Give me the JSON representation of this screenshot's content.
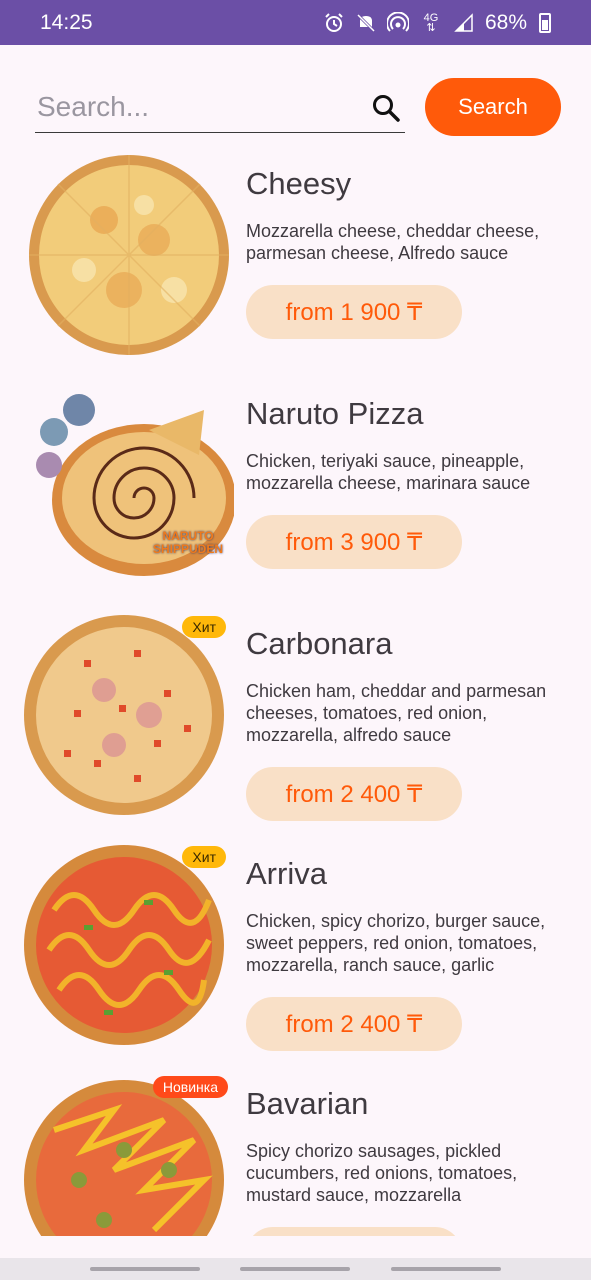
{
  "status_bar": {
    "time": "14:25",
    "battery": "68%",
    "icons": [
      "alarm-icon",
      "mute-icon",
      "hotspot-icon",
      "4g-icon",
      "signal-icon",
      "battery-icon"
    ]
  },
  "search": {
    "placeholder": "Search...",
    "value": "",
    "button_label": "Search"
  },
  "colors": {
    "status_bar": "#6b4fa6",
    "accent": "#ff5a0a",
    "price_bg": "#f9e0c7",
    "badge_hit": "#ffb80a",
    "badge_new": "#ff4a1a"
  },
  "products": [
    {
      "name": "Cheesy",
      "description": "Mozzarella cheese, cheddar cheese, parmesan cheese, Alfredo sauce",
      "price": "from 1 900 ₸",
      "badge": ""
    },
    {
      "name": "Naruto Pizza",
      "description": "Chicken, teriyaki sauce, pineapple, mozzarella cheese, marinara sauce",
      "price": "from 3 900 ₸",
      "badge": "",
      "logo_text": "NARUTO SHIPPUDEN"
    },
    {
      "name": "Carbonara",
      "description": "Chicken ham, cheddar and parmesan cheeses, tomatoes, red onion, mozzarella, alfredo sauce",
      "price": "from 2 400 ₸",
      "badge": "Хит"
    },
    {
      "name": "Arriva",
      "description": "Chicken, spicy chorizo, burger sauce, sweet peppers, red onion, tomatoes, mozzarella, ranch sauce, garlic",
      "price": "from 2 400 ₸",
      "badge": "Хит"
    },
    {
      "name": "Bavarian",
      "description": "Spicy chorizo sausages, pickled cucumbers, red onions, tomatoes, mustard sauce, mozzarella",
      "price": "",
      "badge": "Новинка"
    }
  ]
}
